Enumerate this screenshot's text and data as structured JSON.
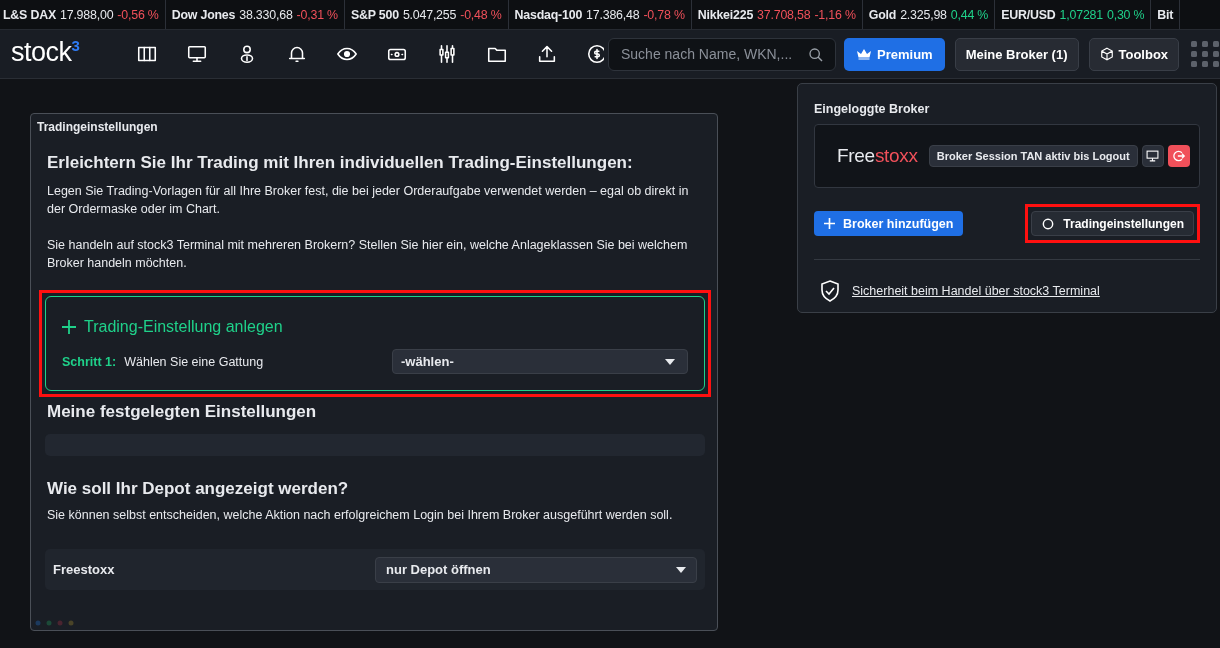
{
  "ticker": [
    {
      "name": "L&S DAX",
      "value": "17.988,00",
      "change": "-0,56 %",
      "color": "#f0505a",
      "value_colored": false
    },
    {
      "name": "Dow Jones",
      "value": "38.330,68",
      "change": "-0,31 %",
      "color": "#f0505a",
      "value_colored": false
    },
    {
      "name": "S&P 500",
      "value": "5.047,255",
      "change": "-0,48 %",
      "color": "#f0505a",
      "value_colored": false
    },
    {
      "name": "Nasdaq-100",
      "value": "17.386,48",
      "change": "-0,78 %",
      "color": "#f0505a",
      "value_colored": false
    },
    {
      "name": "Nikkei225",
      "value": "37.708,58",
      "change": "-1,16 %",
      "color": "#f0505a",
      "value_colored": true
    },
    {
      "name": "Gold",
      "value": "2.325,98",
      "change": "0,44 %",
      "color": "#1fd18a",
      "value_colored": false
    },
    {
      "name": "EUR/USD",
      "value": "1,07281",
      "change": "0,30 %",
      "color": "#1fd18a",
      "value_colored": true
    },
    {
      "name": "Bit"
    }
  ],
  "header": {
    "logo": {
      "text": "stock",
      "mark": "3"
    },
    "search": {
      "placeholder": "Suche nach Name, WKN,..."
    },
    "buttons": [
      {
        "kind": "premium",
        "label": "Premium"
      },
      {
        "kind": "plain",
        "label": "Meine Broker (1)"
      },
      {
        "kind": "toolbox",
        "label": "Toolbox"
      }
    ]
  },
  "settings_panel": {
    "title": "Tradingeinstellungen",
    "heading": "Erleichtern Sie Ihr Trading mit Ihren individuellen Trading-Einstellungen:",
    "paragraphs": [
      "Legen Sie Trading-Vorlagen für all Ihre Broker fest, die bei jeder Orderaufgabe verwendet werden – egal ob direkt in der Ordermaske oder im Chart.",
      "Sie handeln auf stock3 Terminal mit mehreren Brokern? Stellen Sie hier ein, welche Anlageklassen Sie bei welchem Broker handeln möchten."
    ],
    "create": {
      "title": "Trading-Einstellung anlegen",
      "highlighted": true,
      "step_label": "Schritt 1:",
      "step_text": "Wählen Sie eine Gattung",
      "select": {
        "value": "-wählen-"
      }
    },
    "saved_heading": "Meine festgelegten Einstellungen",
    "depot_heading": "Wie soll Ihr Depot angezeigt werden?",
    "depot_text": "Sie können selbst entscheiden, welche Aktion nach erfolgreichem Login bei Ihrem Broker ausgeführt werden soll.",
    "depot_rows": [
      {
        "broker": "Freestoxx",
        "select": {
          "value": "nur Depot öffnen"
        }
      }
    ]
  },
  "broker_popup": {
    "title": "Eingeloggte Broker",
    "broker": {
      "logo_first": "Free",
      "logo_second": "stoxx",
      "session": "Broker Session TAN aktiv bis Logout"
    },
    "add_button": "Broker hinzufügen",
    "settings_button": {
      "label": "Tradingeinstellungen",
      "highlighted": true
    },
    "security_link": "Sicherheit beim Handel über stock3 Terminal"
  }
}
